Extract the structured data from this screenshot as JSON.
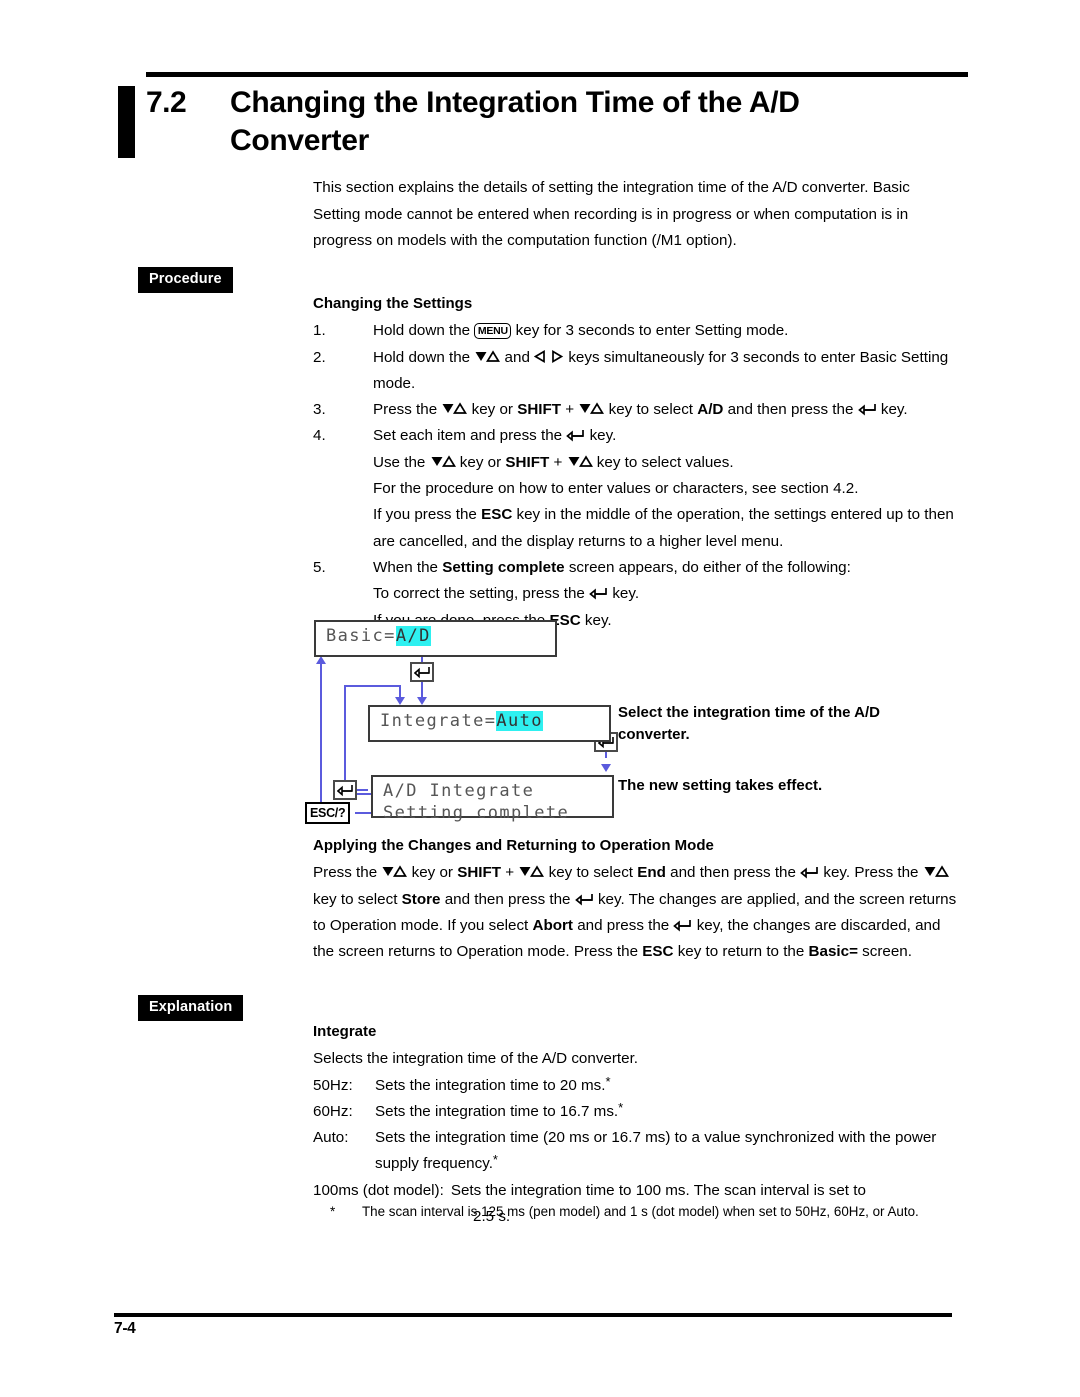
{
  "header": {
    "section_number": "7.2",
    "title": "Changing the Integration Time of the A/D Converter"
  },
  "intro": "This section explains the details of setting the integration time of the A/D converter. Basic Setting mode cannot be entered when recording is in progress or when computation is in progress on models with the computation function (/M1 option).",
  "tags": {
    "procedure": "Procedure",
    "explanation": "Explanation"
  },
  "procedure": {
    "subhead": "Changing the Settings",
    "steps": [
      {
        "num": "1.",
        "parts": [
          {
            "t": "text",
            "v": "Hold down the "
          },
          {
            "t": "key-menu",
            "v": "MENU"
          },
          {
            "t": "text",
            "v": " key for 3 seconds to enter Setting mode."
          }
        ]
      },
      {
        "num": "2.",
        "parts": [
          {
            "t": "text",
            "v": "Hold down the "
          },
          {
            "t": "icon",
            "v": "updown-key-icon"
          },
          {
            "t": "text",
            "v": " and "
          },
          {
            "t": "icon",
            "v": "leftright-key-icon"
          },
          {
            "t": "text",
            "v": " keys simultaneously for 3 seconds to enter Basic Setting mode."
          }
        ]
      },
      {
        "num": "3.",
        "parts": [
          {
            "t": "text",
            "v": "Press the "
          },
          {
            "t": "icon",
            "v": "updown-key-icon"
          },
          {
            "t": "text",
            "v": " key or "
          },
          {
            "t": "bold",
            "v": "SHIFT"
          },
          {
            "t": "text",
            "v": " + "
          },
          {
            "t": "icon",
            "v": "updown-key-icon"
          },
          {
            "t": "text",
            "v": " key to select "
          },
          {
            "t": "bold",
            "v": "A/D"
          },
          {
            "t": "text",
            "v": " and then press the "
          },
          {
            "t": "icon",
            "v": "enter-key-icon"
          },
          {
            "t": "text",
            "v": " key."
          }
        ]
      },
      {
        "num": "4.",
        "parts": [
          {
            "t": "text",
            "v": "Set each item and press the "
          },
          {
            "t": "icon",
            "v": "enter-key-icon"
          },
          {
            "t": "text",
            "v": " key."
          }
        ]
      },
      {
        "num": "5.",
        "parts": [
          {
            "t": "text",
            "v": "When the "
          },
          {
            "t": "bold",
            "v": "Setting complete"
          },
          {
            "t": "text",
            "v": " screen appears, do either of the following:"
          }
        ]
      }
    ],
    "step4_notes": [
      [
        {
          "t": "text",
          "v": "Use the "
        },
        {
          "t": "icon",
          "v": "updown-key-icon"
        },
        {
          "t": "text",
          "v": " key or "
        },
        {
          "t": "bold",
          "v": "SHIFT"
        },
        {
          "t": "text",
          "v": " + "
        },
        {
          "t": "icon",
          "v": "updown-key-icon"
        },
        {
          "t": "text",
          "v": " key to select values."
        }
      ],
      [
        {
          "t": "text",
          "v": "For the procedure on how to enter values or characters, see section 4.2."
        }
      ],
      [
        {
          "t": "text",
          "v": "If you press the "
        },
        {
          "t": "bold",
          "v": "ESC"
        },
        {
          "t": "text",
          "v": " key in the middle of the operation, the settings entered up to then are cancelled, and the display returns to a higher level menu."
        }
      ]
    ],
    "step5_notes": [
      [
        {
          "t": "text",
          "v": "To correct the setting, press the "
        },
        {
          "t": "icon",
          "v": "enter-key-icon"
        },
        {
          "t": "text",
          "v": " key."
        }
      ],
      [
        {
          "t": "text",
          "v": "If you are done, press the "
        },
        {
          "t": "bold",
          "v": "ESC"
        },
        {
          "t": "text",
          "v": " key."
        }
      ]
    ]
  },
  "diagram": {
    "screens": [
      {
        "name": "basic-screen",
        "line1_prefix": "Basic=",
        "line1_highlight": "A/D",
        "line2": ""
      },
      {
        "name": "integrate-screen",
        "line1_prefix": "Integrate=",
        "line1_highlight": "Auto",
        "line2": ""
      },
      {
        "name": "setting-complete-screen",
        "line1_prefix": "A/D Integrate",
        "line1_highlight": "",
        "line2": "Setting complete"
      }
    ],
    "esc_button_label": "ESC/?",
    "callouts": [
      "Select the integration time of the A/D converter.",
      "The new setting takes effect."
    ]
  },
  "apply": {
    "subhead": "Applying the Changes and Returning to Operation Mode",
    "parts": [
      {
        "t": "text",
        "v": "Press the "
      },
      {
        "t": "icon",
        "v": "updown-key-icon"
      },
      {
        "t": "text",
        "v": " key or "
      },
      {
        "t": "bold",
        "v": "SHIFT"
      },
      {
        "t": "text",
        "v": " + "
      },
      {
        "t": "icon",
        "v": "updown-key-icon"
      },
      {
        "t": "text",
        "v": " key to select "
      },
      {
        "t": "bold",
        "v": "End"
      },
      {
        "t": "text",
        "v": " and then press the "
      },
      {
        "t": "icon",
        "v": "enter-key-icon"
      },
      {
        "t": "text",
        "v": " key.  Press the "
      },
      {
        "t": "icon",
        "v": "updown-key-icon"
      },
      {
        "t": "text",
        "v": " key to select "
      },
      {
        "t": "bold",
        "v": "Store"
      },
      {
        "t": "text",
        "v": " and then press the "
      },
      {
        "t": "icon",
        "v": "enter-key-icon"
      },
      {
        "t": "text",
        "v": " key.  The changes are applied, and the screen returns to Operation mode.  If you select "
      },
      {
        "t": "bold",
        "v": "Abort"
      },
      {
        "t": "text",
        "v": " and press the "
      },
      {
        "t": "icon",
        "v": "enter-key-icon"
      },
      {
        "t": "text",
        "v": " key, the changes are discarded, and the screen returns to Operation mode.  Press the "
      },
      {
        "t": "bold",
        "v": "ESC"
      },
      {
        "t": "text",
        "v": " key to return to the "
      },
      {
        "t": "bold",
        "v": "Basic="
      },
      {
        "t": "text",
        "v": " screen."
      }
    ]
  },
  "explanation": {
    "subhead": "Integrate",
    "lead": "Selects the integration time of the A/D converter.",
    "options": [
      {
        "term": "50Hz:",
        "desc": "Sets the integration time to 20 ms.",
        "star": true
      },
      {
        "term": "60Hz:",
        "desc": "Sets the integration time to 16.7 ms.",
        "star": true
      },
      {
        "term": "Auto:",
        "desc": "Sets the integration time (20 ms or 16.7 ms) to a value synchronized with the power supply frequency.",
        "star": true
      }
    ],
    "dot_option": {
      "term": "100ms (dot model):",
      "desc": "Sets the integration time to 100 ms.  The scan interval is set to",
      "desc_indent": "2.5 s."
    },
    "footnote": {
      "mark": "*",
      "text": "The scan interval is 125 ms (pen model) and 1 s (dot model) when set to 50Hz, 60Hz, or Auto."
    }
  },
  "footer": {
    "page_number": "7-4"
  },
  "colors": {
    "highlight_cyan": "#2ef0f0",
    "flow_line_blue": "#5b5bdd",
    "tag_background": "#000000"
  }
}
